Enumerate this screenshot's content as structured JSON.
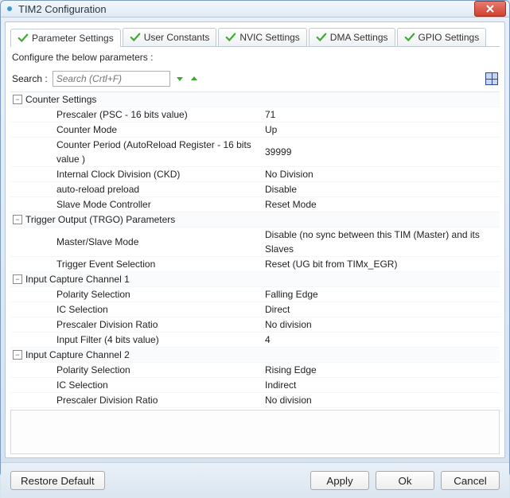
{
  "window": {
    "title": "TIM2 Configuration"
  },
  "tabs": [
    {
      "label": "Parameter Settings"
    },
    {
      "label": "User Constants"
    },
    {
      "label": "NVIC Settings"
    },
    {
      "label": "DMA Settings"
    },
    {
      "label": "GPIO Settings"
    }
  ],
  "instruction": "Configure the below parameters :",
  "search": {
    "label": "Search :",
    "placeholder": "Search (Crtl+F)"
  },
  "groups": [
    {
      "title": "Counter Settings",
      "rows": [
        {
          "label": "Prescaler (PSC - 16 bits value)",
          "value": "71"
        },
        {
          "label": "Counter Mode",
          "value": "Up"
        },
        {
          "label": "Counter Period (AutoReload Register - 16 bits value )",
          "value": "39999"
        },
        {
          "label": "Internal Clock Division (CKD)",
          "value": "No Division"
        },
        {
          "label": "auto-reload preload",
          "value": "Disable"
        },
        {
          "label": "Slave Mode Controller",
          "value": "Reset Mode"
        }
      ]
    },
    {
      "title": "Trigger Output (TRGO) Parameters",
      "rows": [
        {
          "label": "Master/Slave Mode",
          "value": "Disable (no sync between this TIM (Master) and its Slaves"
        },
        {
          "label": "Trigger Event Selection",
          "value": "Reset (UG bit from TIMx_EGR)"
        }
      ]
    },
    {
      "title": "Input Capture Channel 1",
      "rows": [
        {
          "label": "Polarity Selection",
          "value": "Falling Edge"
        },
        {
          "label": "IC Selection",
          "value": "Direct"
        },
        {
          "label": "Prescaler Division Ratio",
          "value": "No division"
        },
        {
          "label": "Input Filter (4 bits value)",
          "value": "4"
        }
      ]
    },
    {
      "title": "Input Capture Channel 2",
      "rows": [
        {
          "label": "Polarity Selection",
          "value": "Rising Edge"
        },
        {
          "label": "IC Selection",
          "value": "Indirect"
        },
        {
          "label": "Prescaler Division Ratio",
          "value": "No division"
        }
      ]
    }
  ],
  "buttons": {
    "restore": "Restore Default",
    "apply": "Apply",
    "ok": "Ok",
    "cancel": "Cancel"
  }
}
